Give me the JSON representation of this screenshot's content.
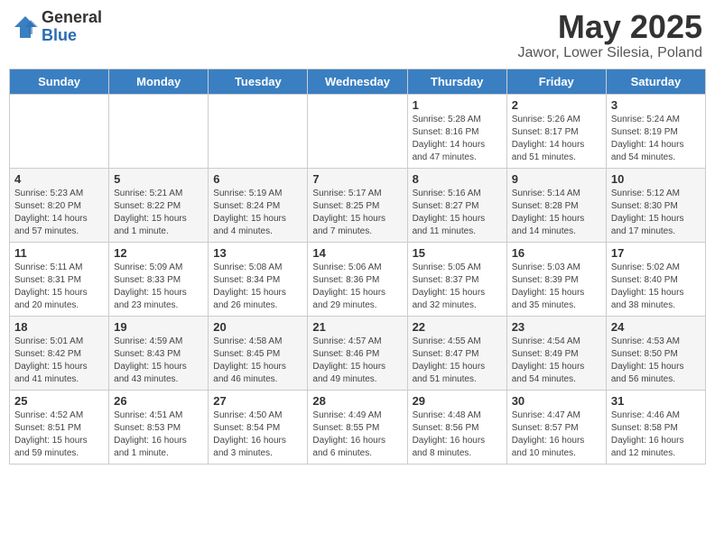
{
  "header": {
    "logo_general": "General",
    "logo_blue": "Blue",
    "title": "May 2025",
    "subtitle": "Jawor, Lower Silesia, Poland"
  },
  "days_of_week": [
    "Sunday",
    "Monday",
    "Tuesday",
    "Wednesday",
    "Thursday",
    "Friday",
    "Saturday"
  ],
  "weeks": [
    [
      {
        "day": "",
        "info": ""
      },
      {
        "day": "",
        "info": ""
      },
      {
        "day": "",
        "info": ""
      },
      {
        "day": "",
        "info": ""
      },
      {
        "day": "1",
        "info": "Sunrise: 5:28 AM\nSunset: 8:16 PM\nDaylight: 14 hours\nand 47 minutes."
      },
      {
        "day": "2",
        "info": "Sunrise: 5:26 AM\nSunset: 8:17 PM\nDaylight: 14 hours\nand 51 minutes."
      },
      {
        "day": "3",
        "info": "Sunrise: 5:24 AM\nSunset: 8:19 PM\nDaylight: 14 hours\nand 54 minutes."
      }
    ],
    [
      {
        "day": "4",
        "info": "Sunrise: 5:23 AM\nSunset: 8:20 PM\nDaylight: 14 hours\nand 57 minutes."
      },
      {
        "day": "5",
        "info": "Sunrise: 5:21 AM\nSunset: 8:22 PM\nDaylight: 15 hours\nand 1 minute."
      },
      {
        "day": "6",
        "info": "Sunrise: 5:19 AM\nSunset: 8:24 PM\nDaylight: 15 hours\nand 4 minutes."
      },
      {
        "day": "7",
        "info": "Sunrise: 5:17 AM\nSunset: 8:25 PM\nDaylight: 15 hours\nand 7 minutes."
      },
      {
        "day": "8",
        "info": "Sunrise: 5:16 AM\nSunset: 8:27 PM\nDaylight: 15 hours\nand 11 minutes."
      },
      {
        "day": "9",
        "info": "Sunrise: 5:14 AM\nSunset: 8:28 PM\nDaylight: 15 hours\nand 14 minutes."
      },
      {
        "day": "10",
        "info": "Sunrise: 5:12 AM\nSunset: 8:30 PM\nDaylight: 15 hours\nand 17 minutes."
      }
    ],
    [
      {
        "day": "11",
        "info": "Sunrise: 5:11 AM\nSunset: 8:31 PM\nDaylight: 15 hours\nand 20 minutes."
      },
      {
        "day": "12",
        "info": "Sunrise: 5:09 AM\nSunset: 8:33 PM\nDaylight: 15 hours\nand 23 minutes."
      },
      {
        "day": "13",
        "info": "Sunrise: 5:08 AM\nSunset: 8:34 PM\nDaylight: 15 hours\nand 26 minutes."
      },
      {
        "day": "14",
        "info": "Sunrise: 5:06 AM\nSunset: 8:36 PM\nDaylight: 15 hours\nand 29 minutes."
      },
      {
        "day": "15",
        "info": "Sunrise: 5:05 AM\nSunset: 8:37 PM\nDaylight: 15 hours\nand 32 minutes."
      },
      {
        "day": "16",
        "info": "Sunrise: 5:03 AM\nSunset: 8:39 PM\nDaylight: 15 hours\nand 35 minutes."
      },
      {
        "day": "17",
        "info": "Sunrise: 5:02 AM\nSunset: 8:40 PM\nDaylight: 15 hours\nand 38 minutes."
      }
    ],
    [
      {
        "day": "18",
        "info": "Sunrise: 5:01 AM\nSunset: 8:42 PM\nDaylight: 15 hours\nand 41 minutes."
      },
      {
        "day": "19",
        "info": "Sunrise: 4:59 AM\nSunset: 8:43 PM\nDaylight: 15 hours\nand 43 minutes."
      },
      {
        "day": "20",
        "info": "Sunrise: 4:58 AM\nSunset: 8:45 PM\nDaylight: 15 hours\nand 46 minutes."
      },
      {
        "day": "21",
        "info": "Sunrise: 4:57 AM\nSunset: 8:46 PM\nDaylight: 15 hours\nand 49 minutes."
      },
      {
        "day": "22",
        "info": "Sunrise: 4:55 AM\nSunset: 8:47 PM\nDaylight: 15 hours\nand 51 minutes."
      },
      {
        "day": "23",
        "info": "Sunrise: 4:54 AM\nSunset: 8:49 PM\nDaylight: 15 hours\nand 54 minutes."
      },
      {
        "day": "24",
        "info": "Sunrise: 4:53 AM\nSunset: 8:50 PM\nDaylight: 15 hours\nand 56 minutes."
      }
    ],
    [
      {
        "day": "25",
        "info": "Sunrise: 4:52 AM\nSunset: 8:51 PM\nDaylight: 15 hours\nand 59 minutes."
      },
      {
        "day": "26",
        "info": "Sunrise: 4:51 AM\nSunset: 8:53 PM\nDaylight: 16 hours\nand 1 minute."
      },
      {
        "day": "27",
        "info": "Sunrise: 4:50 AM\nSunset: 8:54 PM\nDaylight: 16 hours\nand 3 minutes."
      },
      {
        "day": "28",
        "info": "Sunrise: 4:49 AM\nSunset: 8:55 PM\nDaylight: 16 hours\nand 6 minutes."
      },
      {
        "day": "29",
        "info": "Sunrise: 4:48 AM\nSunset: 8:56 PM\nDaylight: 16 hours\nand 8 minutes."
      },
      {
        "day": "30",
        "info": "Sunrise: 4:47 AM\nSunset: 8:57 PM\nDaylight: 16 hours\nand 10 minutes."
      },
      {
        "day": "31",
        "info": "Sunrise: 4:46 AM\nSunset: 8:58 PM\nDaylight: 16 hours\nand 12 minutes."
      }
    ]
  ]
}
